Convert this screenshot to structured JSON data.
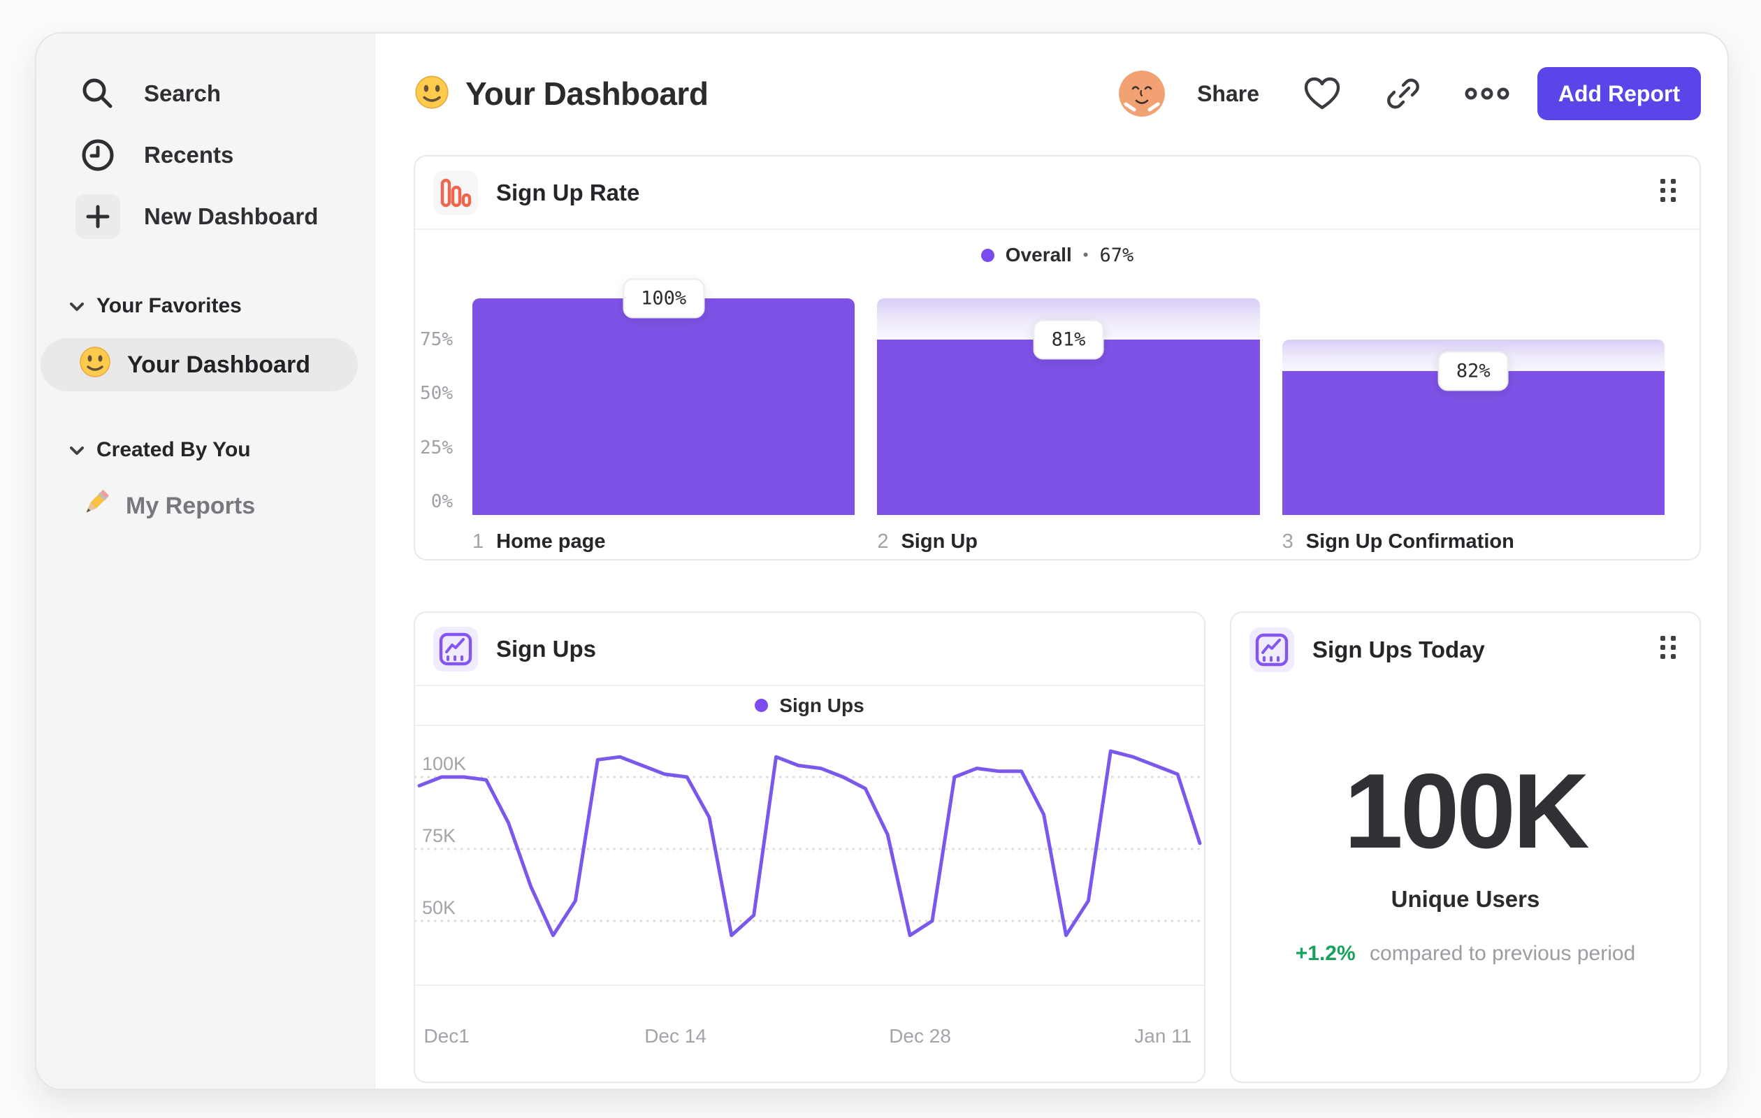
{
  "header": {
    "title": "Your Dashboard",
    "share_label": "Share",
    "add_report_label": "Add Report"
  },
  "sidebar": {
    "search_label": "Search",
    "recents_label": "Recents",
    "new_dashboard_label": "New Dashboard",
    "favorites_section_label": "Your Favorites",
    "favorite_item_label": "Your Dashboard",
    "created_section_label": "Created By You",
    "created_item_label": "My Reports"
  },
  "signup_rate_card": {
    "title": "Sign Up Rate",
    "legend_name": "Overall",
    "legend_sep": "•",
    "legend_value": "67%"
  },
  "signups_card": {
    "title": "Sign Ups",
    "legend_name": "Sign Ups"
  },
  "today_card": {
    "title": "Sign Ups Today",
    "value": "100K",
    "label": "Unique Users",
    "delta": "+1.2%",
    "delta_text": "compared to previous period"
  },
  "icons": {
    "sidebar": [
      "search-icon",
      "clock-icon",
      "plus-icon",
      "chevron-down-icon",
      "smiley-emoji-icon",
      "pencil-emoji-icon"
    ],
    "header": [
      "smiley-emoji-icon",
      "avatar",
      "heart-icon",
      "link-icon",
      "ellipsis-icon"
    ],
    "cards": [
      "funnel-bars-icon",
      "line-chart-icon",
      "drag-handle-icon"
    ]
  },
  "colors": {
    "bar_purple": "#7e52e6",
    "line_purple": "#7b58ec",
    "legend_dot_purple": "#7a4bef",
    "button_purple": "#5a46e8",
    "funnel_icon_orange": "#f0664d",
    "delta_green": "#18a15c",
    "axis_gray": "#a3a4aa"
  },
  "chart_data": [
    {
      "type": "bar",
      "subtype": "funnel",
      "title": "Sign Up Rate",
      "legend": "Overall • 67%",
      "legend_position": "top-center",
      "categories": [
        "Home page",
        "Sign Up",
        "Sign Up Confirmation"
      ],
      "step_indices": [
        "1",
        "2",
        "3"
      ],
      "values": [
        100,
        81,
        82
      ],
      "value_labels": [
        "100%",
        "81%",
        "82%"
      ],
      "cumulative_pct": [
        100,
        81,
        66.4
      ],
      "overall_conversion_pct": 67,
      "ylabel": "",
      "xlabel": "",
      "ylim": [
        0,
        100
      ],
      "y_ticks": [
        {
          "label": "75%",
          "pct": 75
        },
        {
          "label": "50%",
          "pct": 50
        },
        {
          "label": "25%",
          "pct": 25
        },
        {
          "label": "0%",
          "pct": 0
        }
      ],
      "grid": false
    },
    {
      "type": "line",
      "title": "Sign Ups",
      "legend": "Sign Ups",
      "legend_position": "top-center",
      "series": [
        {
          "name": "Sign Ups",
          "values_thousands": [
            97,
            100,
            100,
            99,
            84,
            62,
            45,
            57,
            106,
            107,
            104,
            101,
            100,
            86,
            45,
            52,
            107,
            104,
            103,
            100,
            96,
            80,
            45,
            50,
            100,
            103,
            102,
            102,
            87,
            45,
            57,
            109,
            107,
            104,
            101,
            77
          ]
        }
      ],
      "x_ticks": [
        {
          "label": "Dec1",
          "x_pct": 1.1,
          "anchor": "start"
        },
        {
          "label": "Dec 14",
          "x_pct": 33,
          "anchor": "middle"
        },
        {
          "label": "Dec 28",
          "x_pct": 64,
          "anchor": "middle"
        },
        {
          "label": "Jan 11",
          "x_pct": 94.8,
          "anchor": "middle"
        }
      ],
      "y_gridlines": [
        {
          "label": "100K",
          "value": 100
        },
        {
          "label": "75K",
          "value": 75
        },
        {
          "label": "50K",
          "value": 50
        }
      ],
      "ylim_thousands": [
        27,
        117.7
      ],
      "grid": "dotted-horizontal"
    }
  ]
}
